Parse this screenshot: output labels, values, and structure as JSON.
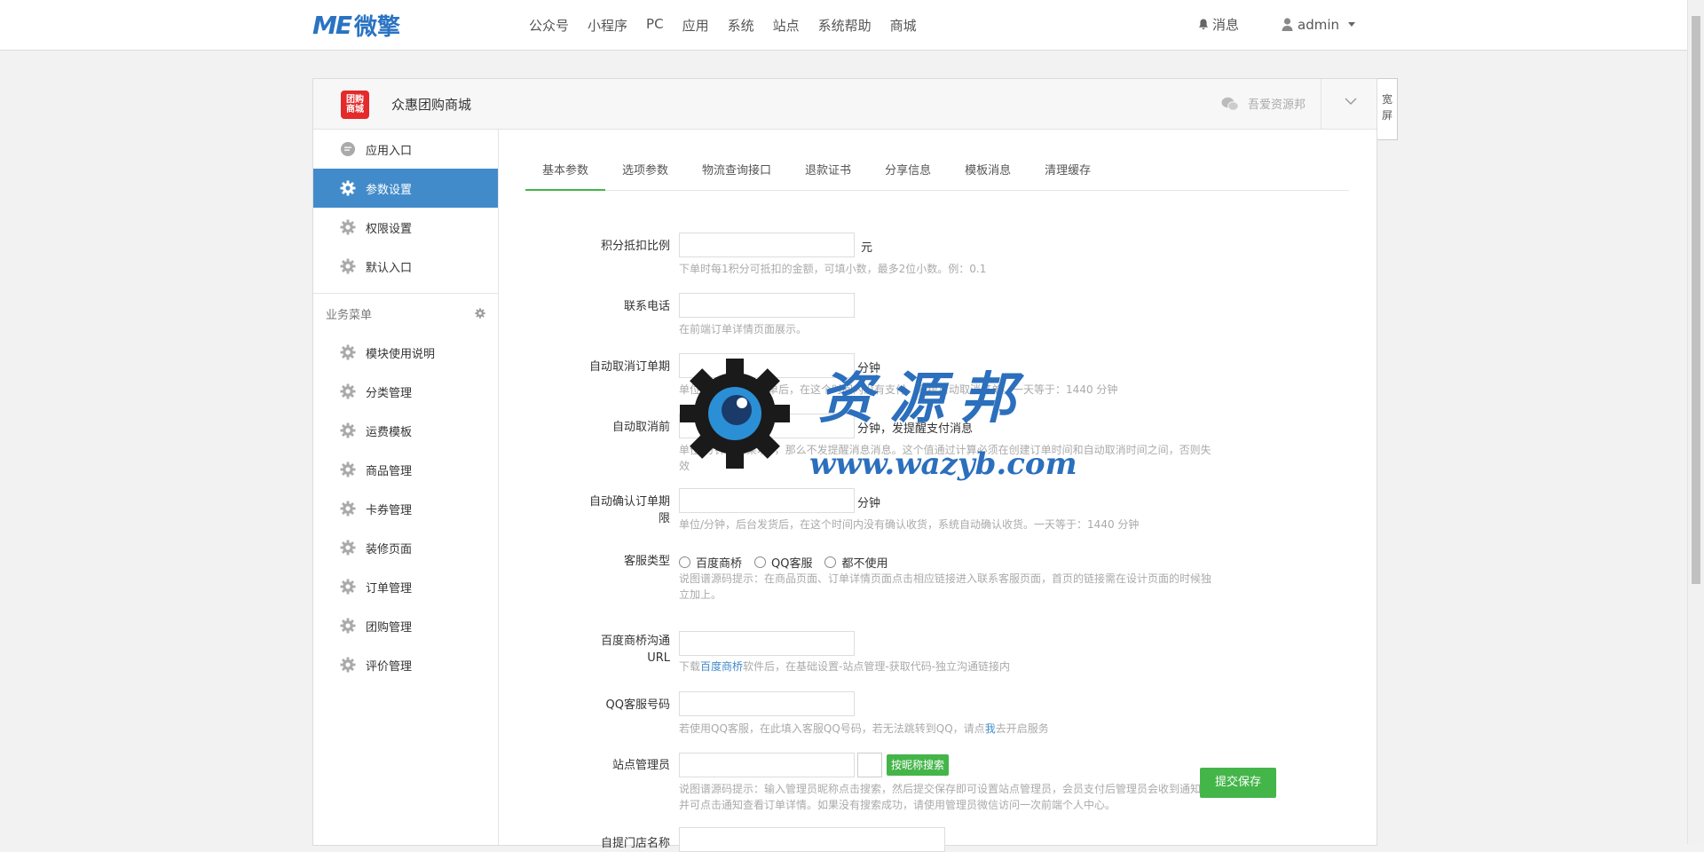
{
  "topbar": {
    "logo_me": "ME",
    "logo_cn": "微擎",
    "nav": [
      "公众号",
      "小程序",
      "PC",
      "应用",
      "系统",
      "站点",
      "系统帮助",
      "商城"
    ],
    "messages_label": "消息",
    "user_label": "admin"
  },
  "panel": {
    "app_logo_text": [
      "团购",
      "商城"
    ],
    "app_name": "众惠团购商城",
    "wechat_label": "吾爱资源邦",
    "wide_label": "宽屏"
  },
  "sidebar": {
    "items": [
      {
        "label": "应用入口",
        "icon": "chat-icon",
        "active": false
      },
      {
        "label": "参数设置",
        "icon": "gear-icon",
        "active": true
      },
      {
        "label": "权限设置",
        "icon": "gear-icon",
        "active": false
      },
      {
        "label": "默认入口",
        "icon": "gear-icon",
        "active": false
      }
    ],
    "group_label": "业务菜单",
    "sub_items": [
      "模块使用说明",
      "分类管理",
      "运费模板",
      "商品管理",
      "卡券管理",
      "装修页面",
      "订单管理",
      "团购管理",
      "评价管理"
    ]
  },
  "tabs": [
    "基本参数",
    "选项参数",
    "物流查询接口",
    "退款证书",
    "分享信息",
    "模板消息",
    "清理缓存"
  ],
  "form": {
    "points_ratio": {
      "label": "积分抵扣比例",
      "unit": "元",
      "help": "下单时每1积分可抵扣的金额，可填小数，最多2位小数。例：0.1"
    },
    "phone": {
      "label": "联系电话",
      "help": "在前端订单详情页面展示。"
    },
    "auto_cancel": {
      "label": "自动取消订单期",
      "unit": "分钟",
      "help": "单位/分钟，会员下单后，在这个时间内没有支付，系统自动取消订单。一天等于：1440 分钟"
    },
    "auto_remind": {
      "label": "自动取消前",
      "unit": "分钟，发提醒支付消息",
      "help": "单位/分钟，如果填0，那么不发提醒消息消息。这个值通过计算必须在创建订单时间和自动取消时间之间，否则失效"
    },
    "auto_confirm": {
      "label": "自动确认订单期限",
      "unit": "分钟",
      "help": "单位/分钟，后台发货后，在这个时间内没有确认收货，系统自动确认收货。一天等于：1440 分钟"
    },
    "cs_type": {
      "label": "客服类型",
      "options": [
        "百度商桥",
        "QQ客服",
        "都不使用"
      ],
      "help": "说图谱源码提示：在商品页面、订单详情页面点击相应链接进入联系客服页面，首页的链接需在设计页面的时候独立加上。"
    },
    "baidu_url": {
      "label": "百度商桥沟通URL",
      "help_pre": "下载",
      "help_link": "百度商桥",
      "help_post": "软件后，在基础设置-站点管理-获取代码-独立沟通链接内"
    },
    "qq": {
      "label": "QQ客服号码",
      "help_pre": "若使用QQ客服，在此填入客服QQ号码，若无法跳转到QQ，请点",
      "help_link": "我",
      "help_post": "去开启服务"
    },
    "admin": {
      "label": "站点管理员",
      "search_btn": "按昵称搜索",
      "help": "说图谱源码提示：输入管理员昵称点击搜索，然后提交保存即可设置站点管理员，会员支付后管理员会收到通知，并可点击通知查看订单详情。如果没有搜索成功，请使用管理员微信访问一次前端个人中心。"
    },
    "store_name": {
      "label": "自提门店名称"
    }
  },
  "save_label": "提交保存",
  "watermark": {
    "text_cn": "资源邦",
    "url": "www.wazyb.com"
  },
  "colors": {
    "brand": "#2a73c2",
    "active": "#428bca",
    "green": "#44b549"
  }
}
